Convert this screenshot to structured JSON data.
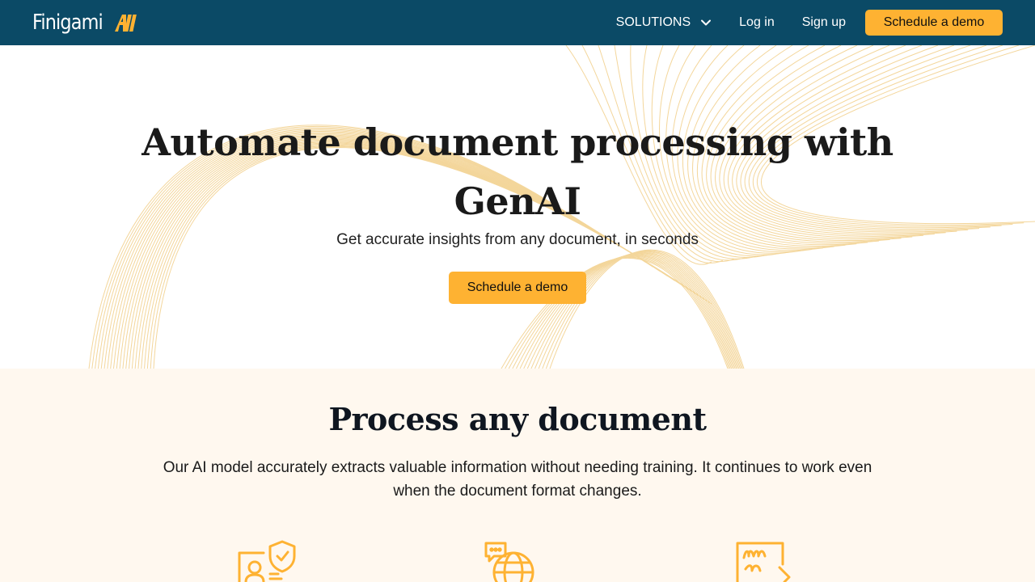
{
  "nav": {
    "logo_text": "Finigami",
    "logo_mark": "AI",
    "solutions_label": "SOLUTIONS",
    "login_label": "Log in",
    "signup_label": "Sign up",
    "cta_label": "Schedule a demo"
  },
  "hero": {
    "title_line1": "Automate document processing with",
    "title_line2": "GenAI",
    "subtitle": "Get accurate insights from any document, in seconds",
    "cta_label": "Schedule a demo"
  },
  "section": {
    "title": "Process any document",
    "description": "Our AI model accurately extracts valuable information without needing training. It continues to work even when the document format changes.",
    "icons": [
      "id-shield-icon",
      "chat-globe-icon",
      "signature-document-icon"
    ]
  },
  "colors": {
    "nav_bg": "#0b4a66",
    "accent": "#feb232",
    "section_bg": "#fff8ef",
    "wave_line": "#f2cf8a"
  }
}
